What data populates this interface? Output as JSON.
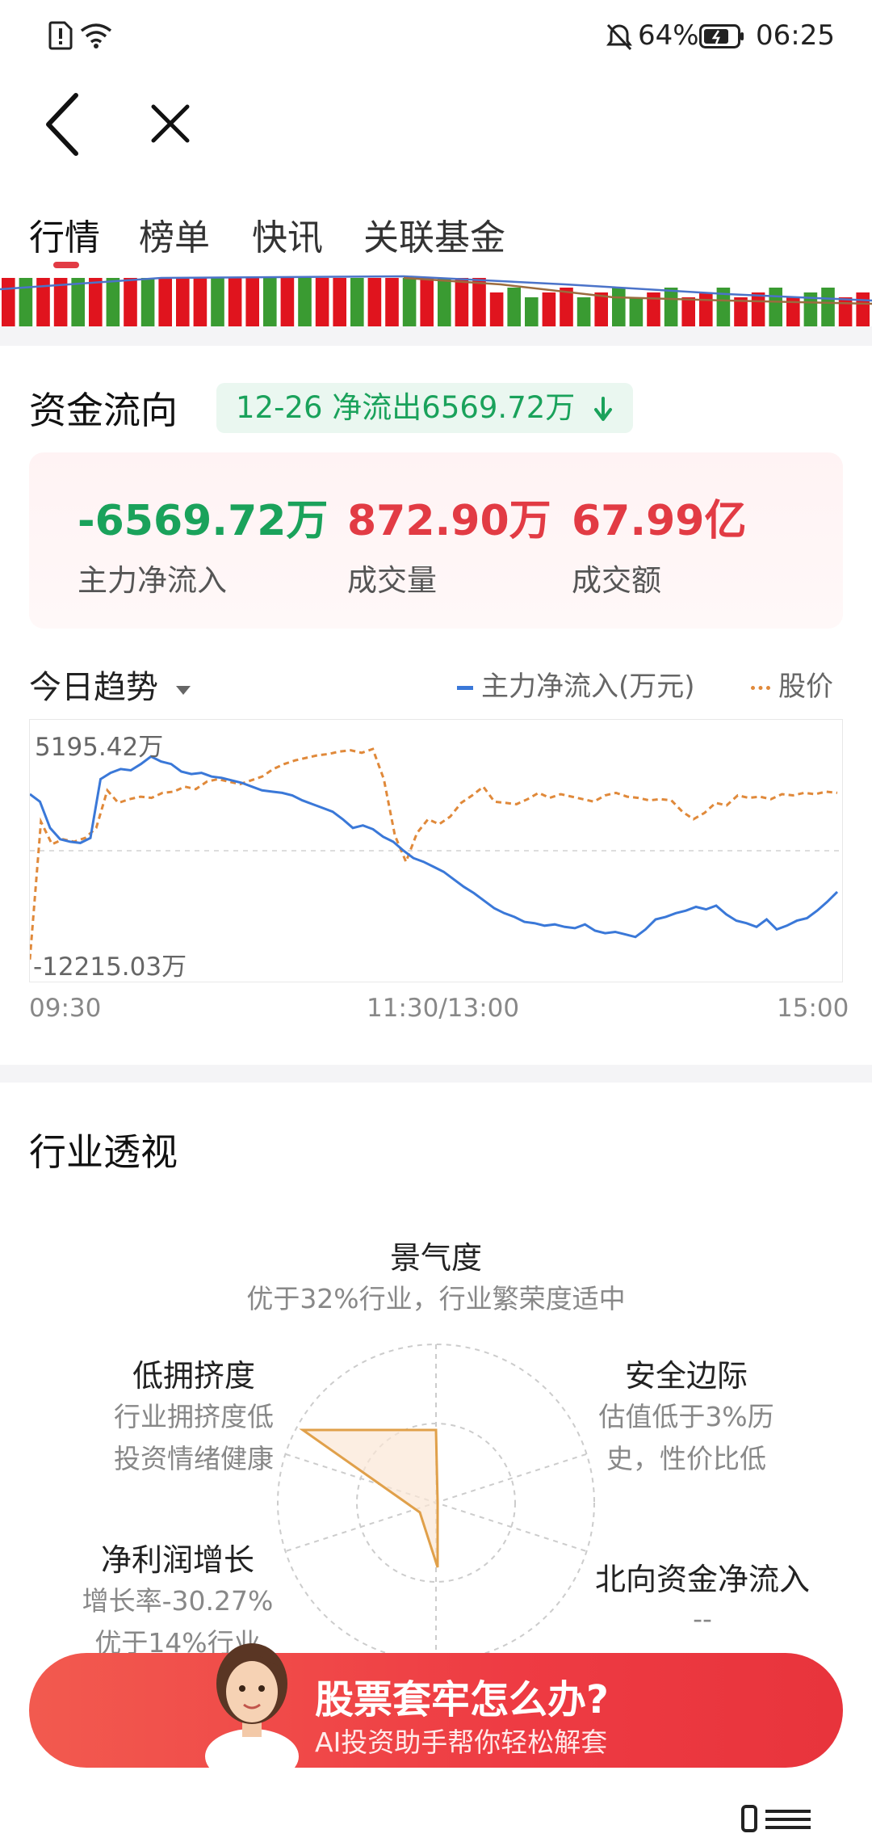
{
  "status_bar": {
    "battery_text": "64%",
    "time": "06:25"
  },
  "nav": {
    "back_icon": "chevron-left-icon",
    "close_icon": "close-icon"
  },
  "tabs": [
    {
      "label": "行情",
      "active": true
    },
    {
      "label": "榜单",
      "active": false
    },
    {
      "label": "快讯",
      "active": false
    },
    {
      "label": "关联基金",
      "active": false
    }
  ],
  "fund_flow": {
    "title": "资金流向",
    "badge": "12-26 净流出6569.72万",
    "badge_icon": "down-arrow-icon",
    "metrics": [
      {
        "value": "-6569.72万",
        "label": "主力净流入",
        "color": "#1aa25b"
      },
      {
        "value": "872.90万",
        "label": "成交量",
        "color": "#e23b44"
      },
      {
        "value": "67.99亿",
        "label": "成交额",
        "color": "#e23b44"
      }
    ]
  },
  "trend": {
    "title": "今日趋势",
    "legend_flow": "主力净流入(万元)",
    "legend_price": "股价"
  },
  "chart_data": {
    "type": "line",
    "y_max_label": "5195.42万",
    "y_min_label": "-12215.03万",
    "x_labels": [
      "09:30",
      "11:30/13:00",
      "15:00"
    ],
    "ylim": [
      -12215.03,
      5195.42
    ],
    "series": [
      {
        "name": "主力净流入(万元)",
        "color": "#3a78d8",
        "style": "solid",
        "values": [
          1200,
          600,
          -1500,
          -2400,
          -2600,
          -2700,
          -2300,
          2400,
          2900,
          3200,
          3100,
          3600,
          4200,
          3800,
          3600,
          3000,
          2800,
          2900,
          2600,
          2500,
          2300,
          2100,
          1800,
          1500,
          1400,
          1300,
          1100,
          700,
          400,
          100,
          -200,
          -800,
          -1500,
          -1300,
          -1600,
          -2200,
          -2600,
          -3300,
          -3900,
          -4200,
          -4600,
          -5000,
          -5600,
          -6200,
          -6700,
          -7300,
          -7900,
          -8300,
          -8600,
          -9000,
          -9100,
          -9300,
          -9200,
          -9400,
          -9500,
          -9200,
          -9700,
          -9900,
          -9800,
          -10000,
          -10200,
          -9600,
          -8800,
          -8600,
          -8300,
          -8100,
          -7800,
          -8000,
          -7700,
          -8400,
          -8900,
          -9100,
          -9400,
          -8800,
          -9600,
          -9300,
          -8900,
          -8700,
          -8100,
          -7400,
          -6600
        ]
      },
      {
        "name": "股价",
        "color": "#e0893a",
        "style": "dashed",
        "price_values": [
          -12000,
          -1000,
          -2800,
          -2400,
          -2600,
          -2300,
          -1500,
          1500,
          500,
          800,
          1000,
          900,
          1300,
          1400,
          1800,
          1600,
          2200,
          2400,
          2200,
          2000,
          2300,
          2600,
          3200,
          3600,
          3900,
          4100,
          4300,
          4400,
          4600,
          4700,
          4500,
          4800,
          2400,
          -2100,
          -4200,
          -1900,
          -800,
          -1200,
          -600,
          500,
          1100,
          1800,
          600,
          500,
          400,
          800,
          1300,
          900,
          1200,
          1000,
          800,
          600,
          1100,
          1300,
          1000,
          900,
          700,
          800,
          700,
          -200,
          -800,
          -300,
          500,
          300,
          1100,
          900,
          1000,
          800,
          1200,
          1100,
          1300,
          1200,
          1400,
          1300
        ]
      }
    ]
  },
  "industry": {
    "title": "行业透视",
    "dimensions": [
      {
        "name": "景气度",
        "desc": [
          "优于32%行业，行业繁荣度适中"
        ]
      },
      {
        "name": "安全边际",
        "desc": [
          "估值低于3%历",
          "史，性价比低"
        ]
      },
      {
        "name": "北向资金净流入",
        "desc": [
          "--"
        ]
      },
      {
        "name": "净利润增长",
        "desc": [
          "增长率-30.27%",
          "优于14%行业"
        ]
      },
      {
        "name": "低拥挤度",
        "desc": [
          "行业拥挤度低",
          "投资情绪健康"
        ]
      }
    ],
    "radar_color": "#e0a04a"
  },
  "banner": {
    "title": "股票套牢怎么办?",
    "subtitle": "AI投资助手帮你轻松解套"
  }
}
